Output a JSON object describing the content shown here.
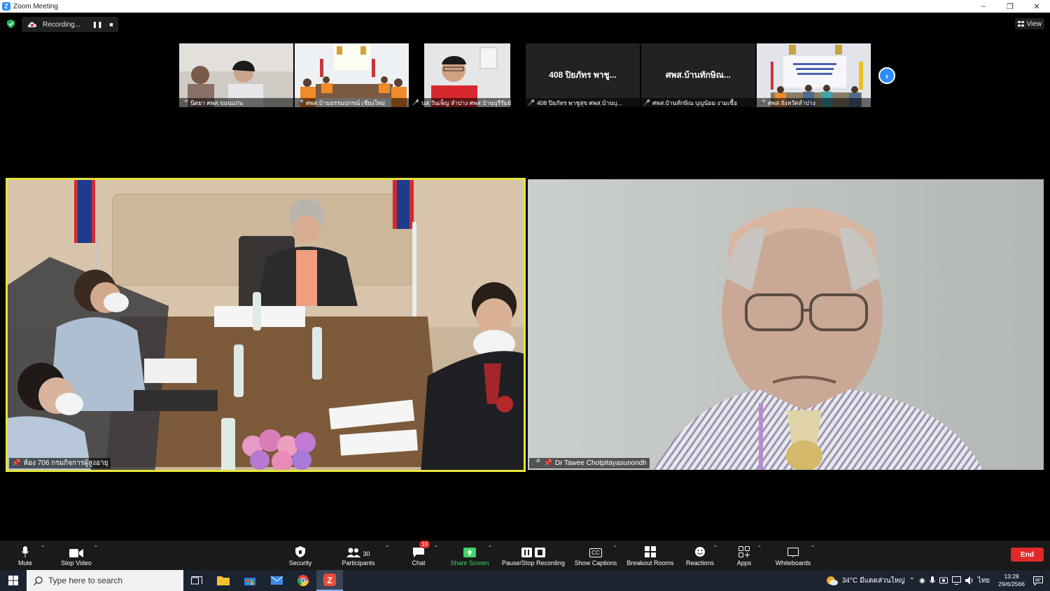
{
  "window": {
    "title": "Zoom Meeting",
    "controls": [
      "–",
      "❐",
      "✕"
    ]
  },
  "recording": {
    "status": "Recording...",
    "pause_glyph": "❚❚",
    "stop_glyph": "■"
  },
  "view_label": "View",
  "thumbnails": [
    {
      "name": "นิดยา ศพส.ขอนแก่น"
    },
    {
      "name": "ศพส.บ้านธรรมปกรณ์ เชียงใหม่"
    },
    {
      "name": "นส.วันเพ็ญ ลำปาง ศพส.บ้านบุรีรัมย์"
    },
    {
      "big": "408 ปิยภัทร  พาชู...",
      "name": "408 ปิยภัทร  พาชูสุข  ศพส.บ้านบุ..."
    },
    {
      "big": "ศพส.บ้านทักษิณ...",
      "name": "ศพส.บ้านทักษิณ บุญน้อม งามเชื้อ"
    },
    {
      "name": "ศพส.จังหวัดลำปาง"
    }
  ],
  "main_tiles": {
    "left_name": "ห้อง 706 กรมกิจการผู้สูงอายุ",
    "right_name": "Dr Tawee Chotpitayasunondh"
  },
  "toolbar": {
    "mute": "Mute",
    "stop_video": "Stop Video",
    "security": "Security",
    "participants": "Participants",
    "participants_count": "30",
    "chat": "Chat",
    "chat_badge": "10",
    "share_screen": "Share Screen",
    "pause_recording": "Pause/Stop Recording",
    "captions": "Show Captions",
    "breakout": "Breakout Rooms",
    "reactions": "Reactions",
    "apps": "Apps",
    "whiteboards": "Whiteboards",
    "end": "End",
    "cc": "CC"
  },
  "taskbar": {
    "search_placeholder": "Type here to search",
    "weather": "34°C  มีแดดส่วนใหญ่",
    "lang": "ไทย",
    "time": "13:28",
    "date": "29/6/2566"
  },
  "colors": {
    "accent": "#2d8cff",
    "active_speaker": "#e5e63a",
    "end": "#e02828",
    "share": "#3fd56b"
  }
}
